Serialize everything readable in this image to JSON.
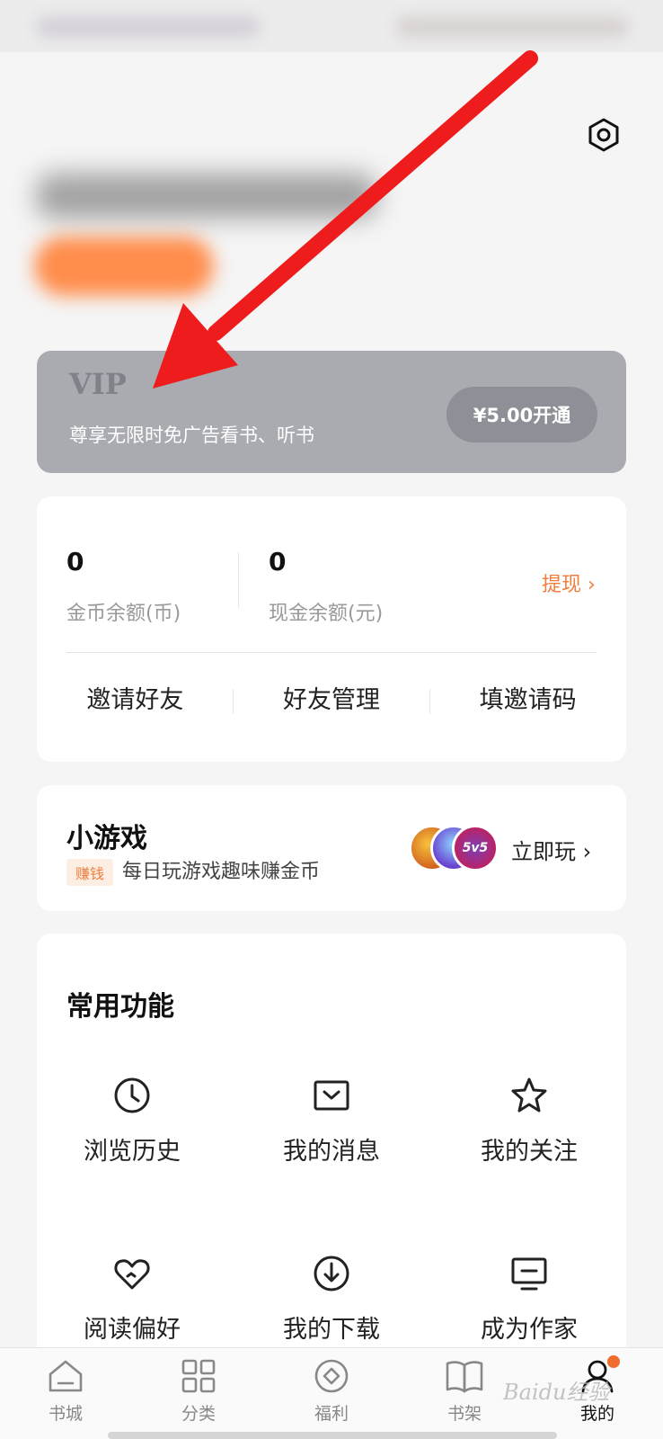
{
  "colors": {
    "accent": "#f07e3c",
    "vip_bg": "#a9abb1",
    "annotation": "#ee1c1c"
  },
  "vip": {
    "title": "VIP",
    "desc": "尊享无限时免广告看书、听书",
    "button": "¥5.00开通"
  },
  "balance": {
    "coins_value": "0",
    "coins_label": "金币余额(币)",
    "cash_value": "0",
    "cash_label": "现金余额(元)",
    "withdraw": "提现 ›",
    "actions": [
      "邀请好友",
      "好友管理",
      "填邀请码"
    ]
  },
  "game": {
    "title": "小游戏",
    "tag": "赚钱",
    "subtitle": "每日玩游戏趣味赚金币",
    "play": "立即玩 ›",
    "badge_text": "5v5"
  },
  "functions": {
    "title": "常用功能",
    "items": [
      {
        "label": "浏览历史",
        "icon": "clock-icon"
      },
      {
        "label": "我的消息",
        "icon": "message-icon"
      },
      {
        "label": "我的关注",
        "icon": "star-icon"
      },
      {
        "label": "阅读偏好",
        "icon": "heart-icon"
      },
      {
        "label": "我的下载",
        "icon": "download-icon"
      },
      {
        "label": "成为作家",
        "icon": "monitor-icon"
      }
    ]
  },
  "nav": {
    "items": [
      {
        "label": "书城",
        "icon": "home-icon"
      },
      {
        "label": "分类",
        "icon": "grid-icon"
      },
      {
        "label": "福利",
        "icon": "coin-icon"
      },
      {
        "label": "书架",
        "icon": "book-icon"
      },
      {
        "label": "我的",
        "icon": "profile-icon"
      }
    ]
  },
  "watermark": "Baidu经验"
}
